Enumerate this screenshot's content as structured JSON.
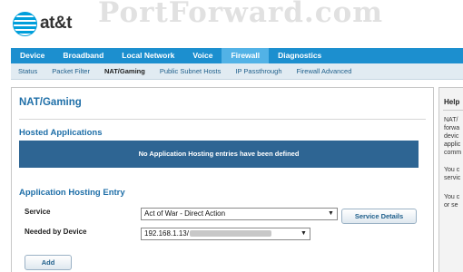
{
  "watermark": "PortForward.com",
  "brand": {
    "name": "at&t"
  },
  "main_nav": {
    "tabs": [
      {
        "label": "Device",
        "active": false
      },
      {
        "label": "Broadband",
        "active": false
      },
      {
        "label": "Local Network",
        "active": false
      },
      {
        "label": "Voice",
        "active": false
      },
      {
        "label": "Firewall",
        "active": true
      },
      {
        "label": "Diagnostics",
        "active": false
      }
    ]
  },
  "sub_nav": {
    "tabs": [
      {
        "label": "Status",
        "active": false
      },
      {
        "label": "Packet Filter",
        "active": false
      },
      {
        "label": "NAT/Gaming",
        "active": true
      },
      {
        "label": "Public Subnet Hosts",
        "active": false
      },
      {
        "label": "IP Passthrough",
        "active": false
      },
      {
        "label": "Firewall Advanced",
        "active": false
      }
    ]
  },
  "page": {
    "title": "NAT/Gaming",
    "hosted_title": "Hosted Applications",
    "hosted_empty_message": "No Application Hosting entries have been defined",
    "entry_title": "Application Hosting Entry",
    "service_label": "Service",
    "service_value": "Act of War - Direct Action",
    "service_details_button": "Service Details",
    "device_label": "Needed by Device",
    "device_value": "192.168.1.13/",
    "add_button": "Add"
  },
  "help": {
    "title": "Help",
    "text_1": "NAT/\nforwa\ndevic\napplic\ncomm",
    "text_2": "You c\nservic",
    "text_3": "You c\nor se"
  },
  "colors": {
    "nav_bar": "#1c8fcf",
    "nav_active": "#52b2e6",
    "sub_nav_bg": "#e1ebf2",
    "heading": "#1f6fa8",
    "banner": "#2e6593"
  }
}
